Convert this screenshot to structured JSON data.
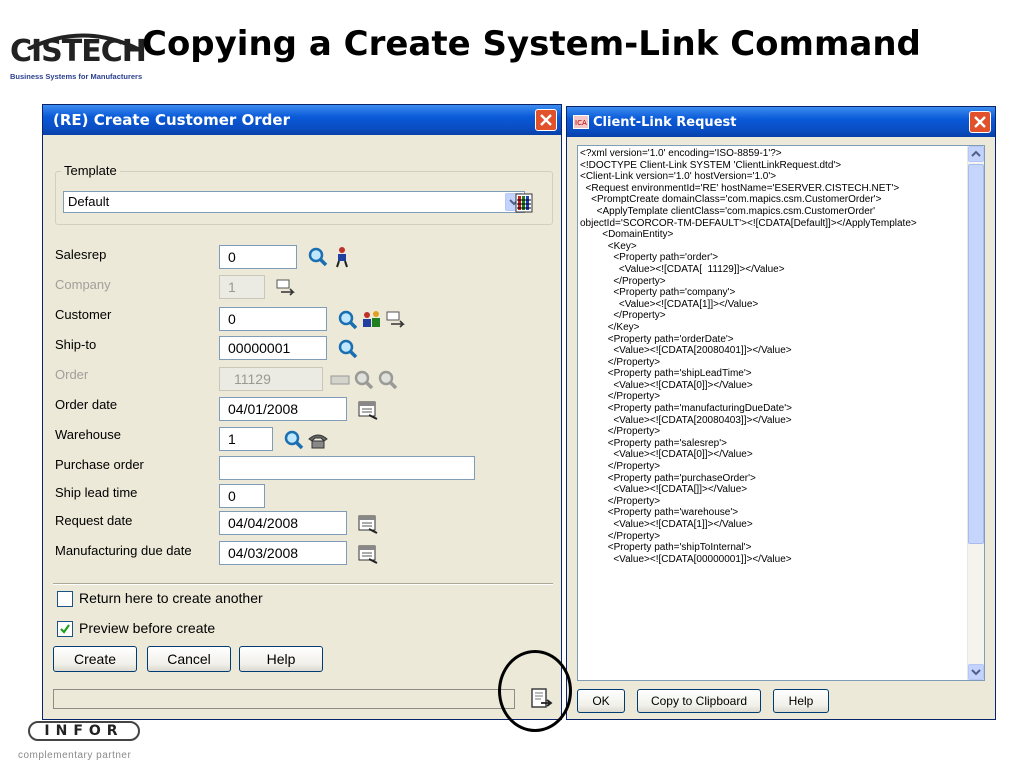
{
  "slide": {
    "logo_text": "CISTECH",
    "logo_tagline": "Business Systems for Manufacturers",
    "title": "Copying a Create System-Link Command",
    "footer_logo": "INFOR",
    "footer_text": "complementary partner"
  },
  "order_window": {
    "title": "(RE) Create Customer Order",
    "template_label": "Template",
    "template_value": "Default",
    "fields": {
      "salesrep": {
        "label": "Salesrep",
        "value": "0"
      },
      "company": {
        "label": "Company",
        "value": "1"
      },
      "customer": {
        "label": "Customer",
        "value": "0"
      },
      "ship_to": {
        "label": "Ship-to",
        "value": "00000001"
      },
      "order": {
        "label": "Order",
        "value": "11129"
      },
      "order_date": {
        "label": "Order date",
        "value": "04/01/2008"
      },
      "warehouse": {
        "label": "Warehouse",
        "value": "1"
      },
      "purchase_order": {
        "label": "Purchase order",
        "value": ""
      },
      "ship_lead_time": {
        "label": "Ship lead time",
        "value": "0"
      },
      "request_date": {
        "label": "Request date",
        "value": "04/04/2008"
      },
      "mfg_due_date": {
        "label": "Manufacturing due date",
        "value": "04/03/2008"
      }
    },
    "return_here_label": "Return here to create another",
    "return_here_checked": false,
    "preview_label": "Preview before create",
    "preview_checked": true,
    "buttons": {
      "create": "Create",
      "cancel": "Cancel",
      "help": "Help"
    }
  },
  "xml_window": {
    "title": "Client-Link Request",
    "lines": [
      "<?xml version='1.0' encoding='ISO-8859-1'?>",
      "<!DOCTYPE Client-Link SYSTEM 'ClientLinkRequest.dtd'>",
      "<Client-Link version='1.0' hostVersion='1.0'>",
      "  <Request environmentId='RE' hostName='ESERVER.CISTECH.NET'>",
      "    <PromptCreate domainClass='com.mapics.csm.CustomerOrder'>",
      "      <ApplyTemplate clientClass='com.mapics.csm.CustomerOrder'",
      "objectId='SCORCOR-TM-DEFAULT'><![CDATA[Default]]></ApplyTemplate>",
      "        <DomainEntity>",
      "          <Key>",
      "            <Property path='order'>",
      "              <Value><![CDATA[  11129]]></Value>",
      "            </Property>",
      "            <Property path='company'>",
      "              <Value><![CDATA[1]]></Value>",
      "            </Property>",
      "          </Key>",
      "          <Property path='orderDate'>",
      "            <Value><![CDATA[20080401]]></Value>",
      "          </Property>",
      "          <Property path='shipLeadTime'>",
      "            <Value><![CDATA[0]]></Value>",
      "          </Property>",
      "          <Property path='manufacturingDueDate'>",
      "            <Value><![CDATA[20080403]]></Value>",
      "          </Property>",
      "          <Property path='salesrep'>",
      "            <Value><![CDATA[0]]></Value>",
      "          </Property>",
      "          <Property path='purchaseOrder'>",
      "            <Value><![CDATA[]]></Value>",
      "          </Property>",
      "          <Property path='warehouse'>",
      "            <Value><![CDATA[1]]></Value>",
      "          </Property>",
      "          <Property path='shipToInternal'>",
      "            <Value><![CDATA[00000001]]></Value>"
    ],
    "buttons": {
      "ok": "OK",
      "copy": "Copy to Clipboard",
      "help": "Help"
    }
  }
}
